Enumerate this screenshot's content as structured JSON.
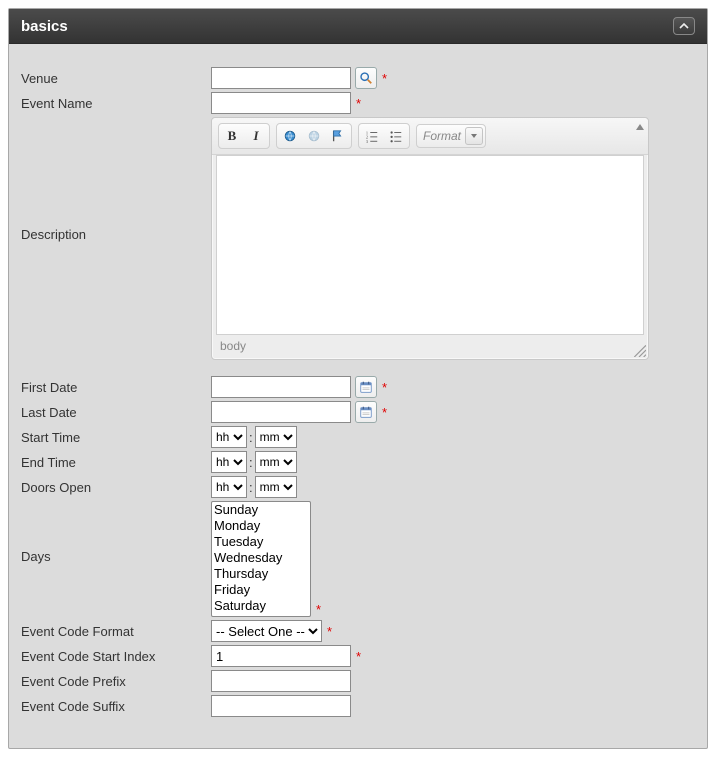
{
  "section": {
    "title": "basics"
  },
  "labels": {
    "venue": "Venue",
    "eventName": "Event Name",
    "description": "Description",
    "firstDate": "First Date",
    "lastDate": "Last Date",
    "startTime": "Start Time",
    "endTime": "End Time",
    "doorsOpen": "Doors Open",
    "days": "Days",
    "eventCodeFormat": "Event Code Format",
    "eventCodeStartIndex": "Event Code Start Index",
    "eventCodePrefix": "Event Code Prefix",
    "eventCodeSuffix": "Event Code Suffix"
  },
  "values": {
    "venue": "",
    "eventName": "",
    "description": "",
    "firstDate": "",
    "lastDate": "",
    "eventCodeStartIndex": "1",
    "eventCodePrefix": "",
    "eventCodeSuffix": ""
  },
  "required_marker": "*",
  "rte": {
    "formatLabel": "Format",
    "pathLabel": "body"
  },
  "time": {
    "hhPlaceholder": "hh",
    "mmPlaceholder": "mm",
    "colon": ":"
  },
  "daysOptions": [
    "Sunday",
    "Monday",
    "Tuesday",
    "Wednesday",
    "Thursday",
    "Friday",
    "Saturday"
  ],
  "eventCodeFormat": {
    "selected": "-- Select One --",
    "options": [
      "-- Select One --"
    ]
  }
}
